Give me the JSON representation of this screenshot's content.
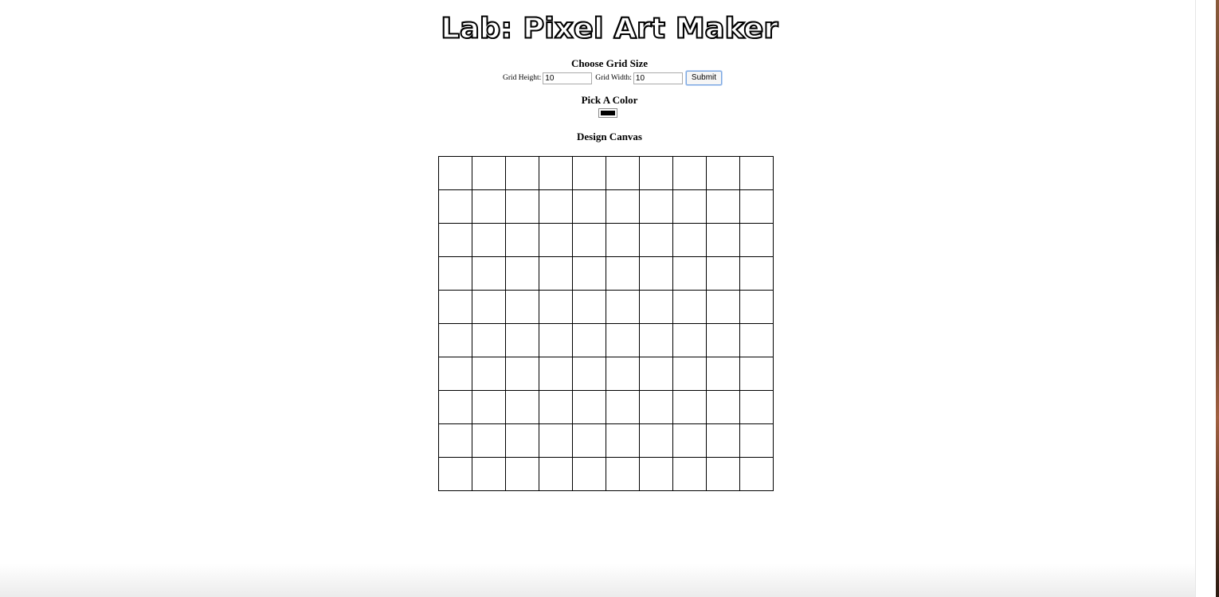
{
  "header": {
    "title": "Lab: Pixel Art Maker"
  },
  "grid_size": {
    "heading": "Choose Grid Size",
    "height_label": "Grid Height:",
    "height_value": "10",
    "width_label": "Grid Width:",
    "width_value": "10",
    "submit_label": "Submit"
  },
  "color_picker": {
    "heading": "Pick A Color",
    "selected_color": "#000000"
  },
  "canvas": {
    "heading": "Design Canvas",
    "rows": 10,
    "columns": 10,
    "cell_color": "#ffffff",
    "border_color": "#000000"
  }
}
